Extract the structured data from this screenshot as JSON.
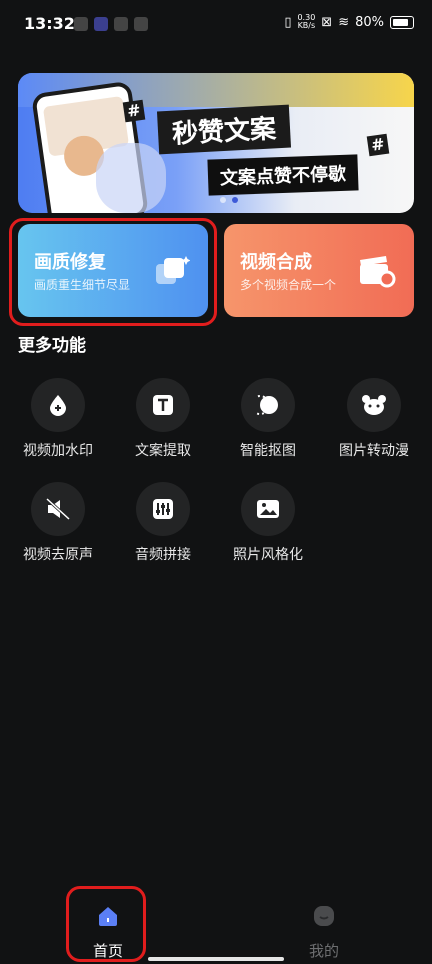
{
  "status_bar": {
    "time": "13:32",
    "speed_top": "0.30",
    "speed_unit": "KB/s",
    "battery": "80%"
  },
  "banner": {
    "title": "秒赞文案",
    "subtitle": "文案点赞不停歇",
    "hash": "#"
  },
  "cards": [
    {
      "title": "画质修复",
      "subtitle": "画质重生细节尽显"
    },
    {
      "title": "视频合成",
      "subtitle": "多个视频合成一个"
    }
  ],
  "section_title": "更多功能",
  "features": [
    {
      "label": "视频加水印",
      "icon": "droplet-plus-icon"
    },
    {
      "label": "文案提取",
      "icon": "text-t-icon"
    },
    {
      "label": "智能抠图",
      "icon": "cutout-circle-icon"
    },
    {
      "label": "图片转动漫",
      "icon": "bear-face-icon"
    },
    {
      "label": "视频去原声",
      "icon": "speaker-mute-icon"
    },
    {
      "label": "音频拼接",
      "icon": "equalizer-icon"
    },
    {
      "label": "照片风格化",
      "icon": "image-icon"
    }
  ],
  "nav": {
    "home_label": "首页",
    "me_label": "我的"
  },
  "colors": {
    "accent": "#3d5ad8",
    "highlight": "#e11d1d",
    "card_blue": "#4f91f0",
    "card_orange": "#f16c55"
  }
}
